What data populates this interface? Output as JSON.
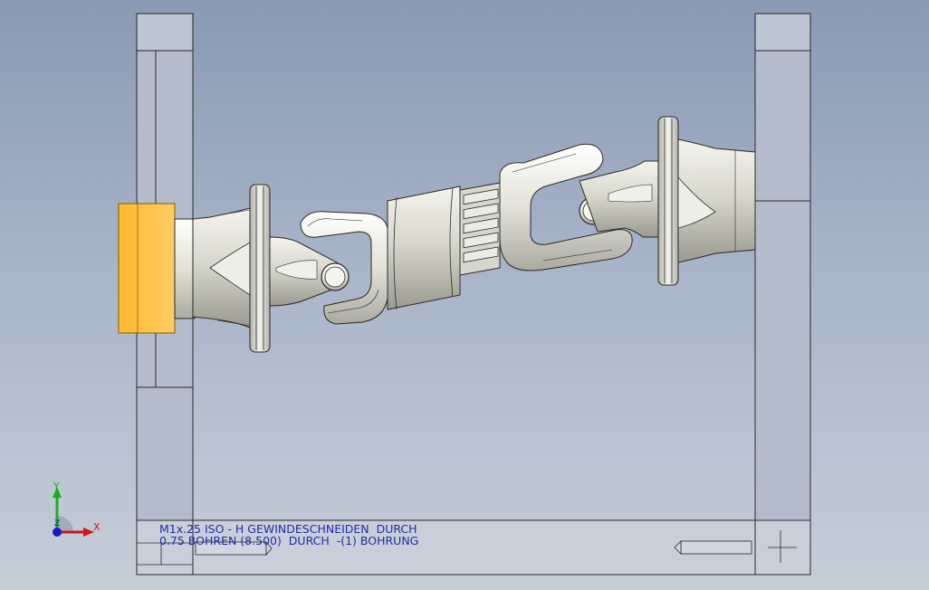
{
  "annotation": {
    "line1": "M1x.25 ISO - H GEWINDESCHNEIDEN  DURCH",
    "line2": "0.75 BOHREN (8.500)  DURCH  -(1) BOHRUNG"
  },
  "triad": {
    "x_label": "X",
    "y_label": "Y",
    "z_label": "Z"
  },
  "colors": {
    "background_top": "#8a9ab4",
    "background_bottom": "#c6ced8",
    "frame_fill": "#b8c0ce",
    "part_highlight": "#ffc34d",
    "part_metal": "#dcdcd2",
    "annotation_text": "#1d2ea8",
    "axis_x": "#d01818",
    "axis_y": "#18b018",
    "axis_z": "#1818c8"
  },
  "icons": {
    "orientation_triad": "xyz-axis-triad-icon"
  }
}
